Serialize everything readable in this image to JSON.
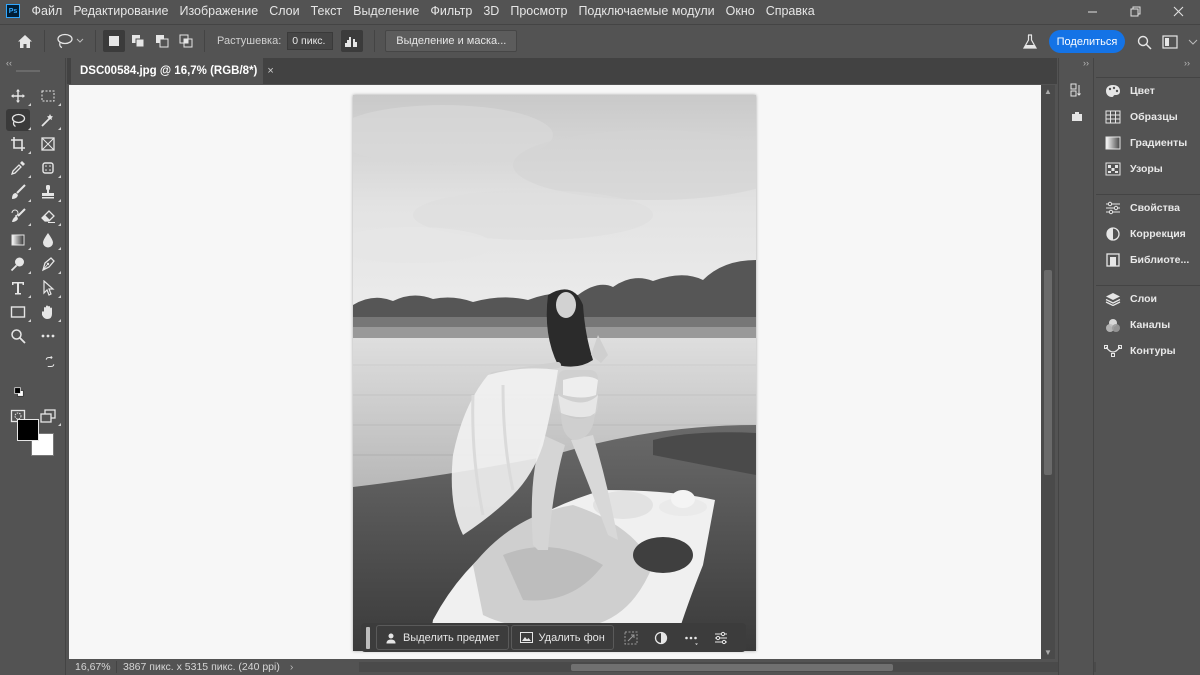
{
  "app": {
    "logo_text": "Ps"
  },
  "menu": [
    "Файл",
    "Редактирование",
    "Изображение",
    "Слои",
    "Текст",
    "Выделение",
    "Фильтр",
    "3D",
    "Просмотр",
    "Подключаемые модули",
    "Окно",
    "Справка"
  ],
  "options_bar": {
    "feather_label": "Растушевка:",
    "feather_value": "0 пикс.",
    "select_mask_label": "Выделение и маска...",
    "share_label": "Поделиться"
  },
  "document": {
    "tab_title": "DSC00584.jpg @ 16,7% (RGB/8*)",
    "close_glyph": "×"
  },
  "context_bar": {
    "select_subject_label": "Выделить предмет",
    "remove_bg_label": "Удалить фон"
  },
  "status": {
    "zoom": "16,67%",
    "doc_info": "3867 пикс. x 5315 пикс. (240 ppi)",
    "arrow": "›"
  },
  "panels": {
    "group1": [
      {
        "label": "Цвет",
        "icon": "color-palette-icon"
      },
      {
        "label": "Образцы",
        "icon": "swatches-grid-icon"
      },
      {
        "label": "Градиенты",
        "icon": "gradient-icon"
      },
      {
        "label": "Узоры",
        "icon": "patterns-icon"
      }
    ],
    "group2": [
      {
        "label": "Свойства",
        "icon": "properties-sliders-icon"
      },
      {
        "label": "Коррекция",
        "icon": "adjustments-icon"
      },
      {
        "label": "Библиоте...",
        "icon": "libraries-icon"
      }
    ],
    "group3": [
      {
        "label": "Слои",
        "icon": "layers-icon"
      },
      {
        "label": "Каналы",
        "icon": "channels-icon"
      },
      {
        "label": "Контуры",
        "icon": "paths-icon"
      }
    ]
  },
  "colors": {
    "foreground": "#000000",
    "background": "#ffffff",
    "accent": "#1473e6"
  }
}
